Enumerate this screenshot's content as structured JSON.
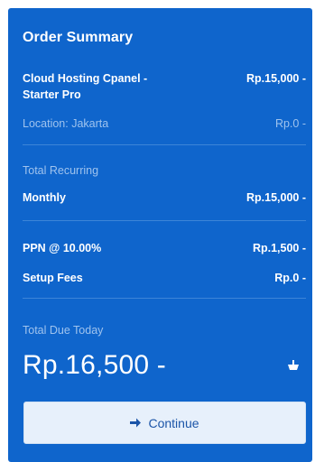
{
  "order_summary": {
    "title": "Order Summary",
    "product": {
      "name": "Cloud Hosting Cpanel - Starter Pro",
      "price": "Rp.15,000 -"
    },
    "location": {
      "label": "Location: Jakarta",
      "price": "Rp.0 -"
    },
    "recurring": {
      "heading": "Total Recurring",
      "label": "Monthly",
      "price": "Rp.15,000 -"
    },
    "tax": {
      "label": "PPN @ 10.00%",
      "price": "Rp.1,500 -"
    },
    "setup": {
      "label": "Setup Fees",
      "price": "Rp.0 -"
    },
    "total_due": {
      "label": "Total Due Today",
      "amount": "Rp.16,500 -"
    },
    "continue_label": "Continue",
    "icons": {
      "cart": "shopping-cart-icon",
      "continue": "arrow-right-icon"
    },
    "colors": {
      "panel": "#0f65cc",
      "muted_text": "#9fc3ee",
      "button_bg": "#e7f0fb",
      "button_text": "#1c55a8"
    }
  }
}
